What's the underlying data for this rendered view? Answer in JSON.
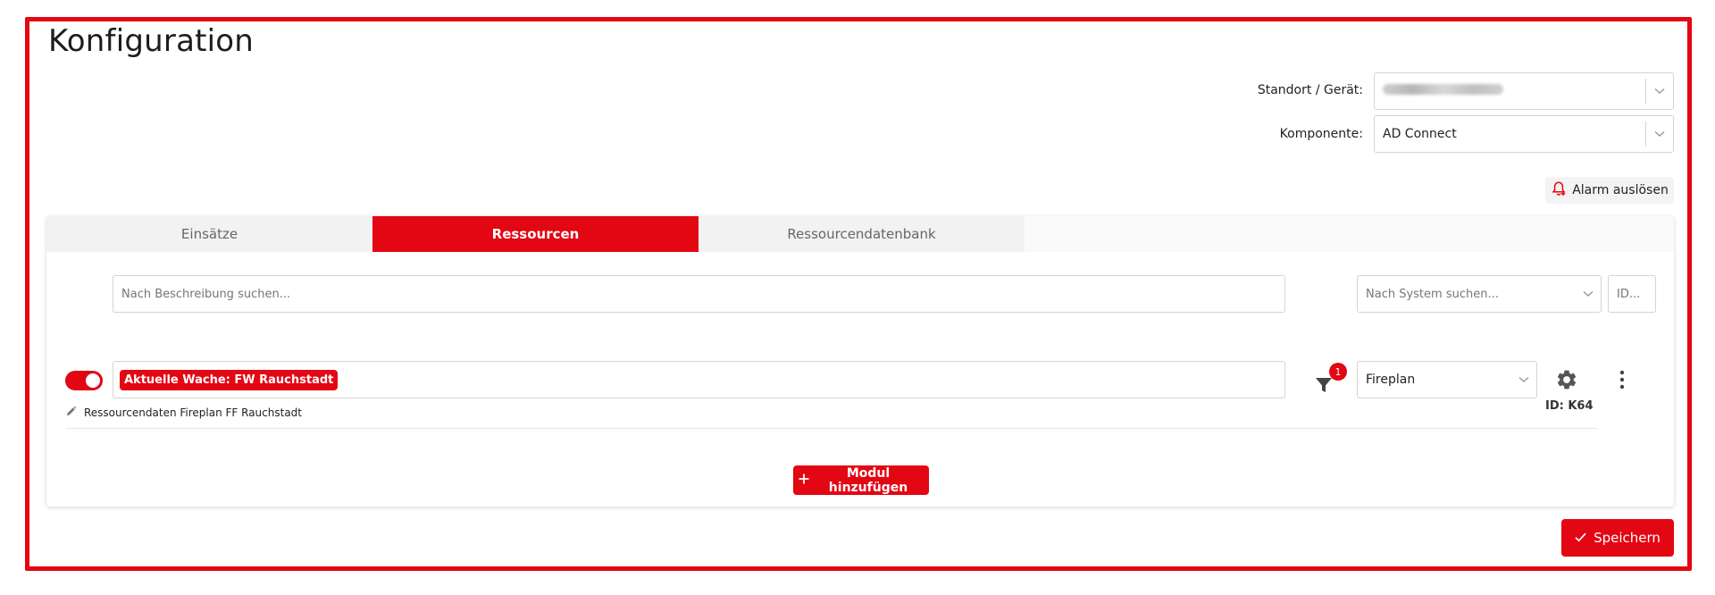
{
  "page": {
    "title": "Konfiguration"
  },
  "filters": {
    "location": {
      "label": "Standort / Gerät:",
      "value": ""
    },
    "component": {
      "label": "Komponente:",
      "value": "AD Connect"
    }
  },
  "alarm": {
    "label": "Alarm auslösen"
  },
  "tabs": [
    {
      "label": "Einsätze",
      "active": false
    },
    {
      "label": "Ressourcen",
      "active": true
    },
    {
      "label": "Ressourcendatenbank",
      "active": false
    }
  ],
  "search": {
    "description_placeholder": "Nach Beschreibung suchen...",
    "system_placeholder": "Nach System suchen...",
    "id_placeholder": "ID..."
  },
  "module": {
    "enabled": true,
    "tag": "Aktuelle Wache: FW Rauchstadt",
    "description": "Ressourcendaten Fireplan FF Rauchstadt",
    "filter_count": "1",
    "system": "Fireplan",
    "id_text": "ID: K64"
  },
  "actions": {
    "add_module": "Modul hinzufügen",
    "save": "Speichern"
  },
  "colors": {
    "accent": "#e30613"
  }
}
